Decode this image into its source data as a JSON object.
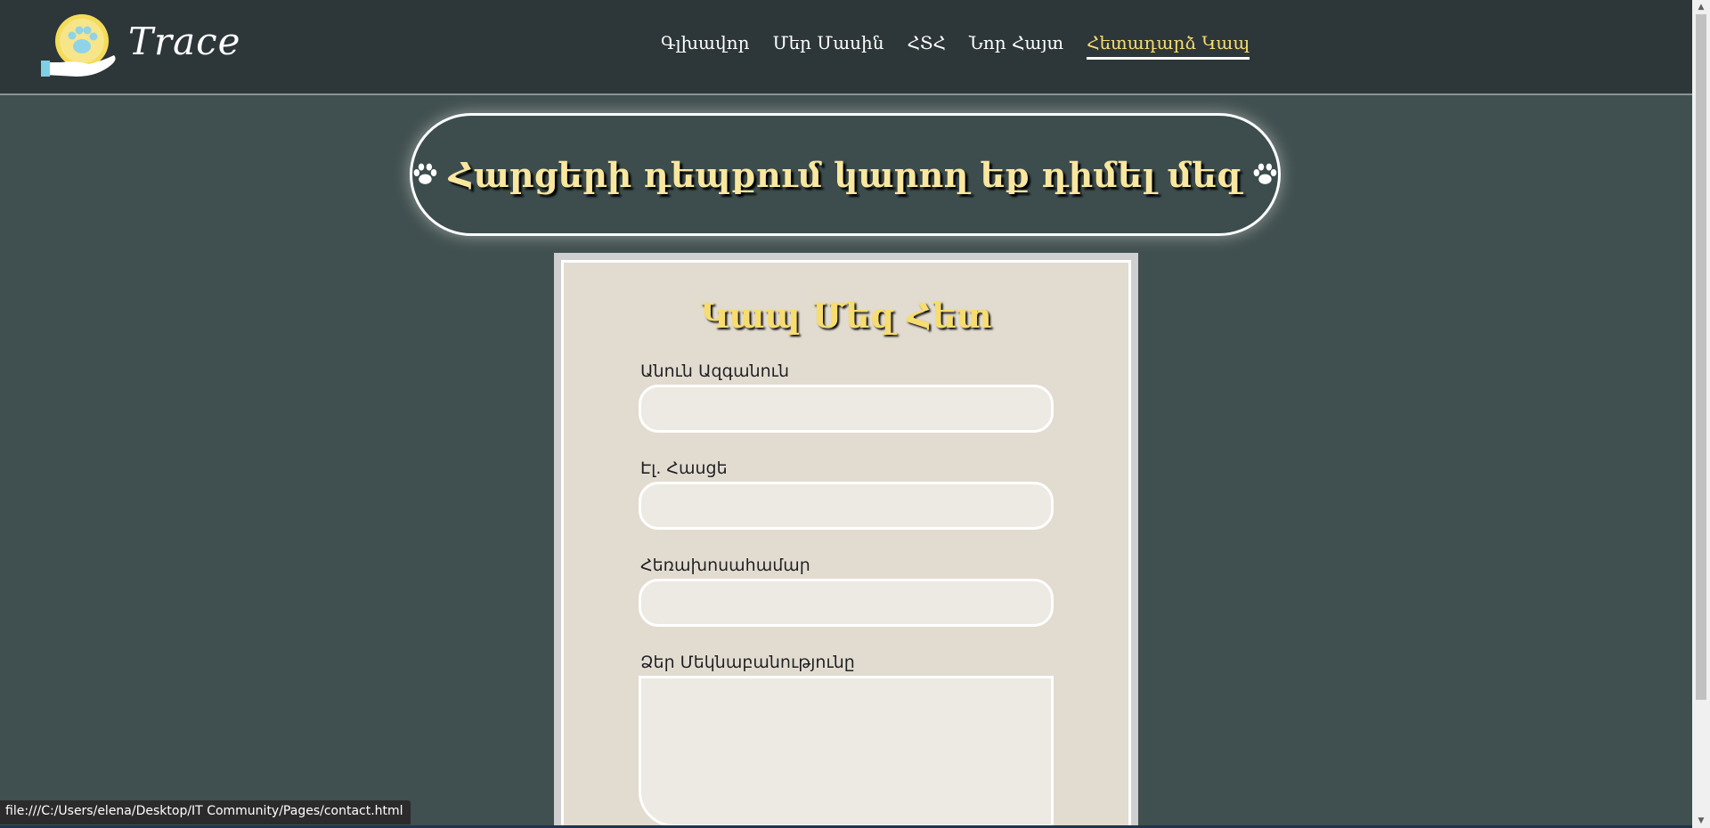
{
  "brand": {
    "name": "Trace"
  },
  "nav": {
    "items": [
      {
        "label": "Գլխավոր"
      },
      {
        "label": "Մեր Մասին"
      },
      {
        "label": "ՀՏՀ"
      },
      {
        "label": "Նոր Հայտ"
      },
      {
        "label": "Հետադարձ Կապ",
        "active": true
      }
    ]
  },
  "hero": {
    "title": "Հարցերի դեպքում կարող եք դիմել մեզ"
  },
  "form": {
    "title": "Կապ Մեզ Հետ",
    "fields": [
      {
        "label": "Անուն Ազգանուն",
        "value": ""
      },
      {
        "label": "Էլ. Հասցե",
        "value": ""
      },
      {
        "label": "Հեռախոսահամար",
        "value": ""
      },
      {
        "label": "Ձեր Մեկնաբանությունը",
        "value": ""
      }
    ]
  },
  "status_bar": {
    "url": "file:///C:/Users/elena/Desktop/IT Community/Pages/contact.html"
  },
  "colors": {
    "header_bg": "#2d3638",
    "page_bg": "#404f4f",
    "accent": "#f7dc6f",
    "card_bg": "#e2dbd0"
  }
}
